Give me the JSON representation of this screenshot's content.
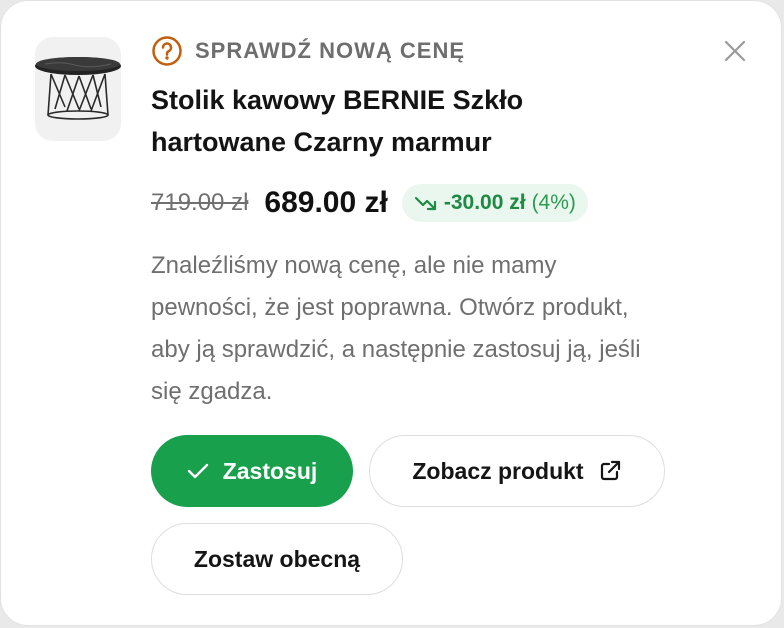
{
  "header": {
    "title": "SPRAWDŹ NOWĄ CENĘ",
    "icon": "question-circle-icon"
  },
  "product": {
    "name": "Stolik kawowy BERNIE Szkło hartowane Czarny marmur",
    "thumbnail_icon": "coffee-table-image"
  },
  "price": {
    "old": "719.00 zł",
    "new": "689.00 zł",
    "change": "-30.00 zł",
    "change_percent": "(4%)",
    "change_icon": "trending-down-icon"
  },
  "message": "Znaleźliśmy nową cenę, ale nie mamy pewności, że jest poprawna. Otwórz produkt, aby ją sprawdzić, a następnie zastosuj ją, jeśli się zgadza.",
  "actions": {
    "apply_label": "Zastosuj",
    "view_label": "Zobacz produkt",
    "keep_label": "Zostaw obecną"
  },
  "colors": {
    "accent_green": "#18a04c",
    "badge_background": "#eaf7ee",
    "warning_orange": "#c25e0d"
  }
}
